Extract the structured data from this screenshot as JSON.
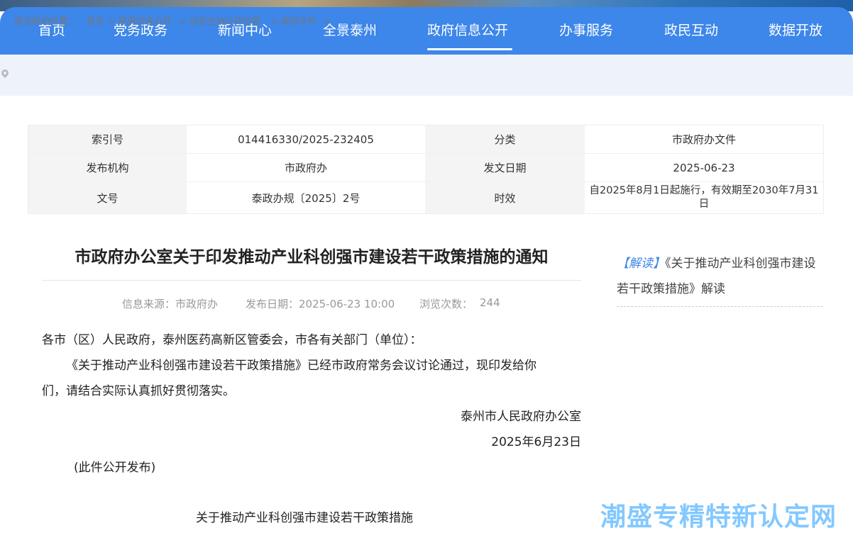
{
  "nav": {
    "items": [
      "首页",
      "党务政务",
      "新闻中心",
      "全景泰州",
      "政府信息公开",
      "办事服务",
      "政民互动",
      "数据开放"
    ]
  },
  "breadcrumb": {
    "prefix": "您当前的位置：",
    "items": [
      "首页",
      "政府信息公开",
      "法定主动公开内容",
      "政府文件",
      "市政府办文件"
    ]
  },
  "info": {
    "index_label": "索引号",
    "index_value": "014416330/2025-232405",
    "category_label": "分类",
    "category_value": "市政府办文件",
    "issuer_label": "发布机构",
    "issuer_value": "市政府办",
    "date_label": "发文日期",
    "date_value": "2025-06-23",
    "docno_label": "文号",
    "docno_value": "泰政办规〔2025〕2号",
    "validity_label": "时效",
    "validity_value": "自2025年8月1日起施行，有效期至2030年7月31日"
  },
  "article": {
    "title": "市政府办公室关于印发推动产业科创强市建设若干政策措施的通知",
    "source": "信息来源：市政府办",
    "publish_date": "发布日期：2025-06-23 10:00",
    "views_label": "浏览次数：",
    "views": "244",
    "salutation": "各市（区）人民政府，泰州医药高新区管委会，市各有关部门（单位）：",
    "para1_line1": "《关于推动产业科创强市建设若干政策措施》已经市政府常务会议讨论通过，现印发给你",
    "para1_line2": "们，请结合实际认真抓好贯彻落实。",
    "signature": "泰州市人民政府办公室",
    "sign_date": "2025年6月23日",
    "note": "(此件公开发布)",
    "subtitle": "关于推动产业科创强市建设若干政策措施"
  },
  "sidebar": {
    "tag": "【解读】",
    "link_text": "《关于推动产业科创强市建设若干政策措施》解读"
  },
  "watermark": "潮盛专精特新认定网",
  "colors": {
    "nav_bg": "#3d86ea",
    "accent": "#3d86ea"
  }
}
